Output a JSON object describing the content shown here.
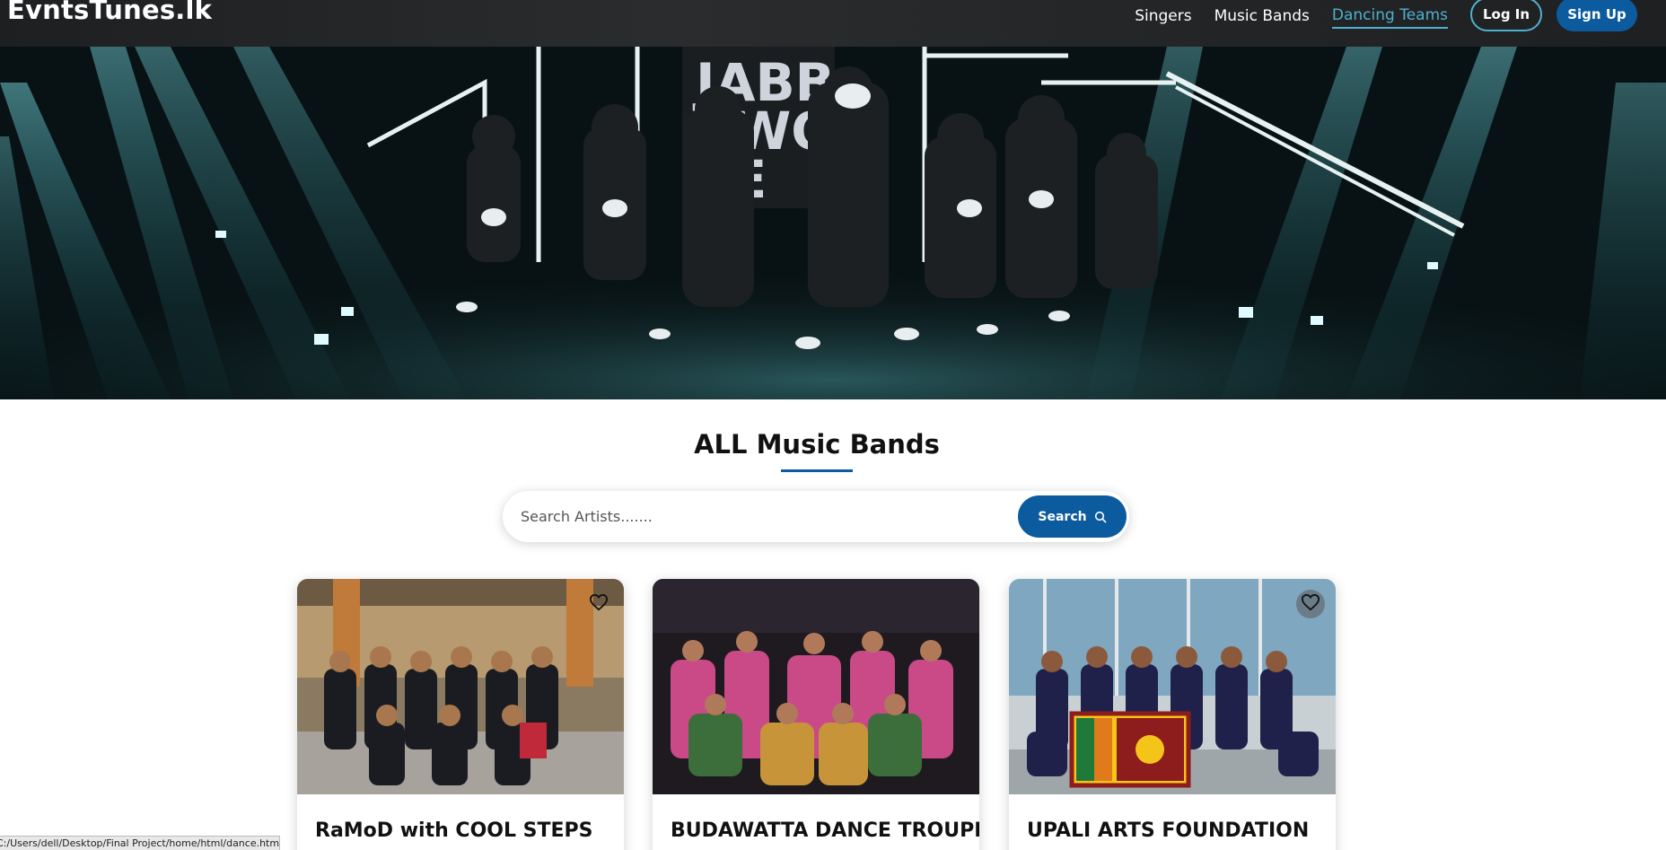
{
  "brand": {
    "logo_text": "EvntsTunes.lk"
  },
  "nav": {
    "links": [
      {
        "label": "Singers",
        "active": false
      },
      {
        "label": "Music Bands",
        "active": false
      },
      {
        "label": "Dancing Teams",
        "active": true
      }
    ],
    "login_label": "Log In",
    "signup_label": "Sign Up"
  },
  "hero": {
    "sign_text": "JABB AWO EE"
  },
  "section": {
    "title": "ALL Music Bands"
  },
  "search": {
    "placeholder": "Search Artists.......",
    "button_label": "Search",
    "icon": "search-icon"
  },
  "cards": [
    {
      "title": "RaMoD with COOL STEPS",
      "favorite_icon": "heart-outline-icon"
    },
    {
      "title": "BUDAWATTA DANCE TROUPE",
      "favorite_icon": "heart-outline-icon"
    },
    {
      "title": "UPALI ARTS FOUNDATION",
      "favorite_icon": "heart-outline-icon"
    }
  ],
  "status_bar": {
    "url": "C:/Users/dell/Desktop/Final Project/home/html/dance.html"
  },
  "colors": {
    "accent": "#4fb0cf",
    "primary": "#0c5b9f",
    "navbar": "#232527"
  }
}
